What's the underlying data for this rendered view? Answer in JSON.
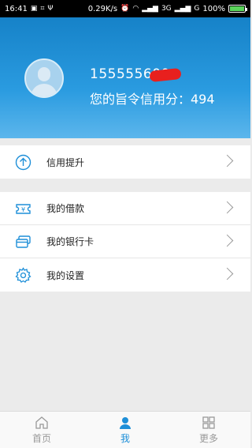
{
  "status_bar": {
    "time": "16:41",
    "network_speed": "0.29K/s",
    "carrier_signal": "3G",
    "carrier_signal_2": "G",
    "battery": "100%",
    "battery_level": 1.0
  },
  "profile": {
    "phone": "155555600",
    "credit_label": "您的旨令信用分：494"
  },
  "menu": {
    "group1": [
      {
        "label": "信用提升",
        "icon": "arrow-up-circle-icon"
      }
    ],
    "group2": [
      {
        "label": "我的借款",
        "icon": "ticket-icon"
      },
      {
        "label": "我的银行卡",
        "icon": "bank-card-icon"
      },
      {
        "label": "我的设置",
        "icon": "gear-icon"
      }
    ]
  },
  "tabs": [
    {
      "label": "首页",
      "icon": "home-icon",
      "active": false
    },
    {
      "label": "我",
      "icon": "person-icon",
      "active": true
    },
    {
      "label": "更多",
      "icon": "grid-icon",
      "active": false
    }
  ],
  "colors": {
    "accent": "#1e8fd8",
    "header_top": "#1682c8",
    "header_bottom": "#5cb6ec"
  }
}
